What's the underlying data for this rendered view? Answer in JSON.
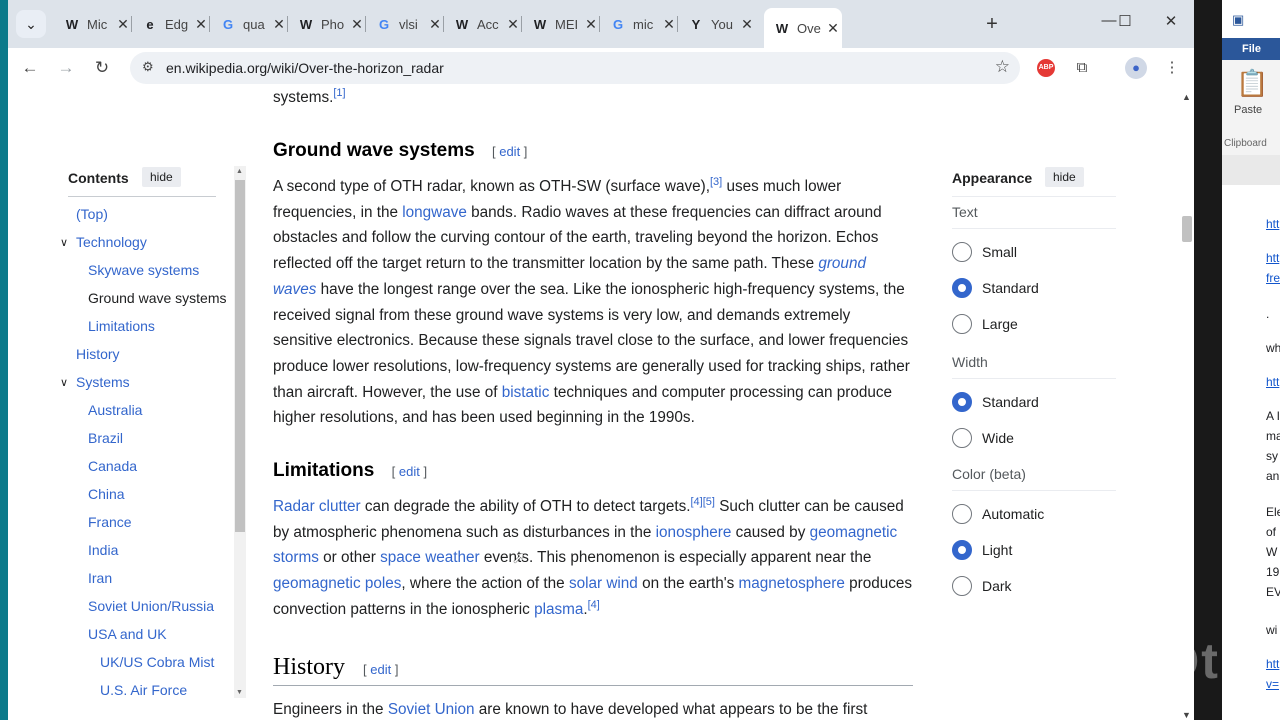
{
  "browser": {
    "tabs": [
      {
        "icon": "W",
        "label": "Mic"
      },
      {
        "icon": "e",
        "label": "Edg"
      },
      {
        "icon": "G",
        "label": "qua"
      },
      {
        "icon": "W",
        "label": "Pho"
      },
      {
        "icon": "G",
        "label": "vlsi"
      },
      {
        "icon": "W",
        "label": "Acc"
      },
      {
        "icon": "W",
        "label": "MEI"
      },
      {
        "icon": "G",
        "label": "mic"
      },
      {
        "icon": "Y",
        "label": "You"
      },
      {
        "icon": "W",
        "label": "Ove"
      }
    ],
    "active_tab_index": 9,
    "url": "en.wikipedia.org/wiki/Over-the-horizon_radar"
  },
  "toc": {
    "title": "Contents",
    "hide_label": "hide",
    "items": [
      {
        "label": "(Top)",
        "level": 0
      },
      {
        "label": "Technology",
        "level": 0,
        "expanded": true
      },
      {
        "label": "Skywave systems",
        "level": 1
      },
      {
        "label": "Ground wave systems",
        "level": 1,
        "active": true
      },
      {
        "label": "Limitations",
        "level": 1
      },
      {
        "label": "History",
        "level": 0
      },
      {
        "label": "Systems",
        "level": 0,
        "expanded": true
      },
      {
        "label": "Australia",
        "level": 1
      },
      {
        "label": "Brazil",
        "level": 1
      },
      {
        "label": "Canada",
        "level": 1
      },
      {
        "label": "China",
        "level": 1
      },
      {
        "label": "France",
        "level": 1
      },
      {
        "label": "India",
        "level": 1
      },
      {
        "label": "Iran",
        "level": 1
      },
      {
        "label": "Soviet Union/Russia",
        "level": 1
      },
      {
        "label": "USA and UK",
        "level": 1
      },
      {
        "label": "UK/US Cobra Mist",
        "level": 2
      },
      {
        "label": "U.S. Air Force",
        "level": 2
      }
    ]
  },
  "article": {
    "prev_tail": "systems.",
    "prev_tail_ref": "[1]",
    "sections": {
      "ground": {
        "heading": "Ground wave systems",
        "edit": "edit",
        "paragraph": [
          {
            "t": "A second type of OTH radar, known as OTH-SW (surface wave),"
          },
          {
            "ref": "[3]"
          },
          {
            "t": " uses much lower frequencies, in the "
          },
          {
            "link": "longwave"
          },
          {
            "t": " bands. Radio waves at these frequencies can diffract around obstacles and follow the curving contour of the earth, traveling beyond the horizon. Echos reflected off the target return to the transmitter location by the same path. These "
          },
          {
            "ilink": "ground waves"
          },
          {
            "t": " have the longest range over the sea. Like the ionospheric high-frequency systems, the received signal from these ground wave systems is very low, and demands extremely sensitive electronics. Because these signals travel close to the surface, and lower frequencies produce lower resolutions, low-frequency systems are generally used for tracking ships, rather than aircraft. However, the use of "
          },
          {
            "link": "bistatic"
          },
          {
            "t": " techniques and computer processing can produce higher resolutions, and has been used beginning in the 1990s."
          }
        ]
      },
      "limitations": {
        "heading": "Limitations",
        "edit": "edit",
        "paragraph": [
          {
            "link": "Radar clutter"
          },
          {
            "t": " can degrade the ability of OTH to detect targets."
          },
          {
            "ref": "[4][5]"
          },
          {
            "t": " Such clutter can be caused by atmospheric phenomena such as disturbances in the "
          },
          {
            "link": "ionosphere"
          },
          {
            "t": " caused by "
          },
          {
            "link": "geomagnetic storms"
          },
          {
            "t": " or other "
          },
          {
            "link": "space weather"
          },
          {
            "t": " events. This phenomenon is especially apparent near the "
          },
          {
            "link": "geomagnetic poles"
          },
          {
            "t": ", where the action of the "
          },
          {
            "link": "solar wind"
          },
          {
            "t": " on the earth's "
          },
          {
            "link": "magnetosphere"
          },
          {
            "t": " produces convection patterns in the ionospheric "
          },
          {
            "link": "plasma"
          },
          {
            "t": "."
          },
          {
            "ref": "[4]"
          }
        ]
      },
      "history": {
        "heading": "History",
        "edit": "edit",
        "paragraph": [
          {
            "t": "Engineers in the "
          },
          {
            "link": "Soviet Union"
          },
          {
            "t": " are known to have developed what appears to be the first"
          }
        ]
      }
    }
  },
  "appearance": {
    "title": "Appearance",
    "hide_label": "hide",
    "groups": [
      {
        "label": "Text",
        "options": [
          {
            "label": "Small",
            "checked": false
          },
          {
            "label": "Standard",
            "checked": true
          },
          {
            "label": "Large",
            "checked": false
          }
        ]
      },
      {
        "label": "Width",
        "options": [
          {
            "label": "Standard",
            "checked": true
          },
          {
            "label": "Wide",
            "checked": false
          }
        ]
      },
      {
        "label": "Color (beta)",
        "options": [
          {
            "label": "Automatic",
            "checked": false
          },
          {
            "label": "Light",
            "checked": true
          },
          {
            "label": "Dark",
            "checked": false
          }
        ]
      }
    ]
  },
  "word_window": {
    "file_tab": "File",
    "paste_label": "Paste",
    "clipboard_label": "Clipboard",
    "doc_snippets": [
      {
        "text": "htt",
        "link": true
      },
      {
        "text": "htt",
        "link": true
      },
      {
        "text": "fre",
        "link": true
      },
      {
        "text": ".",
        "link": false
      },
      {
        "text": "wh",
        "link": false
      },
      {
        "text": "htt",
        "link": true
      },
      {
        "text": "A I",
        "link": false
      },
      {
        "text": "ma",
        "link": false
      },
      {
        "text": "sy",
        "link": false
      },
      {
        "text": "an",
        "link": false
      },
      {
        "text": "Ele",
        "link": false
      },
      {
        "text": "of",
        "link": false
      },
      {
        "text": "W",
        "link": false
      },
      {
        "text": "19",
        "link": false
      },
      {
        "text": "EV",
        "link": false
      },
      {
        "text": "wi",
        "link": false
      },
      {
        "text": "htt",
        "link": true
      },
      {
        "text": "v=",
        "link": true
      }
    ]
  },
  "watermark": "InShOt"
}
